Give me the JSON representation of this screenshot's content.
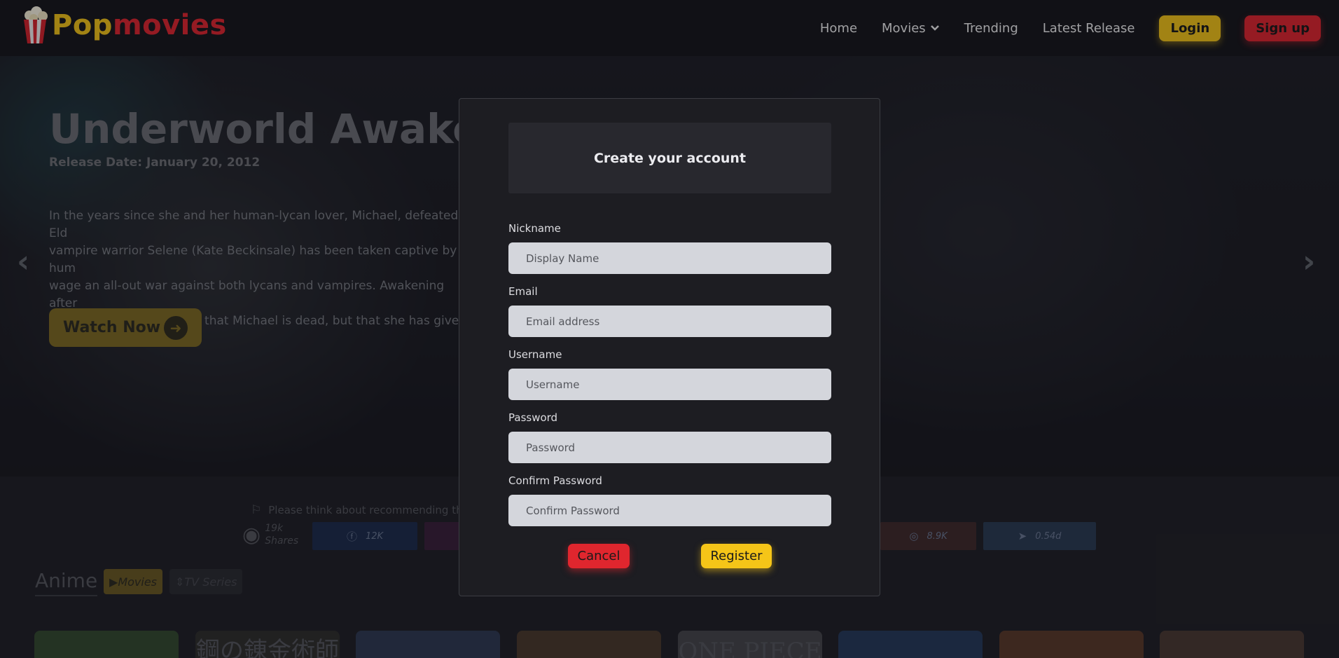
{
  "brand": {
    "pop": "Pop",
    "movies": "movies"
  },
  "nav": {
    "home": "Home",
    "movies": "Movies",
    "trending": "Trending",
    "latest": "Latest Release",
    "login": "Login",
    "signup": "Sign up"
  },
  "hero": {
    "title": "Underworld Awaken",
    "release_date": "Release Date: January 20, 2012",
    "description": "In the years since she and her human-lycan lover, Michael, defeated Eld\nvampire warrior Selene (Kate Beckinsale) has been taken captive by hum\nwage an all-out war against both lycans and vampires. Awakening after\ndecade, Selene discovers that Michael is dead, but that she has given bi",
    "watch_label": "Watch Now"
  },
  "share": {
    "hint": "Please think about recommending this",
    "count": "19k",
    "count_label": "Shares",
    "buttons": [
      {
        "icon": "facebook-icon",
        "value": "12K",
        "color": "#1c2c4c"
      },
      {
        "icon": "messenger-icon",
        "value": "",
        "color": "#3a1f3a"
      },
      {
        "icon": "instagram-icon",
        "value": "8.9K",
        "color": "#3f2a2a"
      },
      {
        "icon": "telegram-icon",
        "value": "0.54d",
        "color": "#2a3b52"
      }
    ]
  },
  "anime": {
    "title": "Anime",
    "chips": {
      "movies": "Movies",
      "tv": "TV Series"
    },
    "posters": [
      "",
      "鋼の錬金術師",
      "",
      "",
      "ONE PIECE",
      "",
      "",
      ""
    ]
  },
  "modal": {
    "title": "Create your account",
    "fields": {
      "nickname": {
        "label": "Nickname",
        "placeholder": "Display Name"
      },
      "email": {
        "label": "Email",
        "placeholder": "Email address"
      },
      "username": {
        "label": "Username",
        "placeholder": "Username"
      },
      "password": {
        "label": "Password",
        "placeholder": "Password"
      },
      "confirm": {
        "label": "Confirm Password",
        "placeholder": "Confirm Password"
      }
    },
    "cancel": "Cancel",
    "register": "Register"
  },
  "colors": {
    "accent_yellow": "#f5c518",
    "accent_red": "#e0262e",
    "nav_bg": "#16161b",
    "modal_bg": "#1d1d22"
  }
}
